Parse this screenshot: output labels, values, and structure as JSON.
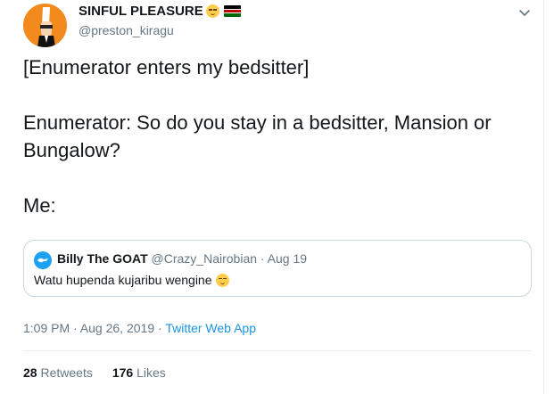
{
  "tweet": {
    "display_name": "SINFUL PLEASURE",
    "handle": "@preston_kiragu",
    "name_emoji": "relieved-face",
    "name_flag": "kenya-flag",
    "text_lines": [
      "[Enumerator enters my bedsitter]",
      "Enumerator: So do you stay in a bedsitter, Mansion or Bungalow?",
      "Me:"
    ],
    "timestamp": "1:09 PM · Aug 26, 2019",
    "separator": " · ",
    "source": "Twitter Web App",
    "retweets_count": "28",
    "retweets_label": "Retweets",
    "likes_count": "176",
    "likes_label": "Likes"
  },
  "quoted": {
    "display_name": "Billy The GOAT",
    "handle": "@Crazy_Nairobian",
    "date": "· Aug 19",
    "text": "Watu hupenda kujaribu wengine",
    "text_emoji": "relieved-face"
  },
  "colors": {
    "link": "#1b95e0",
    "secondary_text": "#657786",
    "border": "#ccd6dd",
    "avatar_bg": "#f28a1e"
  }
}
